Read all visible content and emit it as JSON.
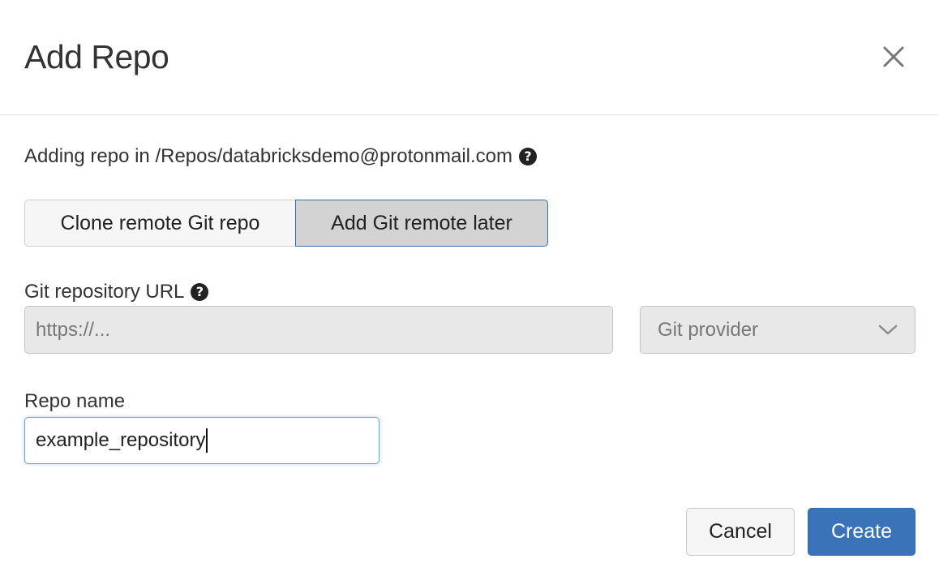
{
  "dialog": {
    "title": "Add Repo",
    "close_icon": "close-icon"
  },
  "path": {
    "text": "Adding repo in /Repos/databricksdemo@protonmail.com",
    "help_icon": "?"
  },
  "mode_toggle": {
    "options": [
      {
        "label": "Clone remote Git repo",
        "selected": false
      },
      {
        "label": "Add Git remote later",
        "selected": true
      }
    ]
  },
  "git_url": {
    "label": "Git repository URL",
    "help_icon": "?",
    "placeholder": "https://...",
    "value": ""
  },
  "git_provider": {
    "placeholder": "Git provider",
    "icon": "chevron-down-icon"
  },
  "repo_name": {
    "label": "Repo name",
    "value": "example_repository"
  },
  "footer": {
    "cancel_label": "Cancel",
    "create_label": "Create"
  },
  "colors": {
    "primary": "#3b73b9",
    "focus_border": "#6fa5de",
    "selected_toggle_bg": "#d3d3d3",
    "disabled_bg": "#e8e8e8"
  }
}
